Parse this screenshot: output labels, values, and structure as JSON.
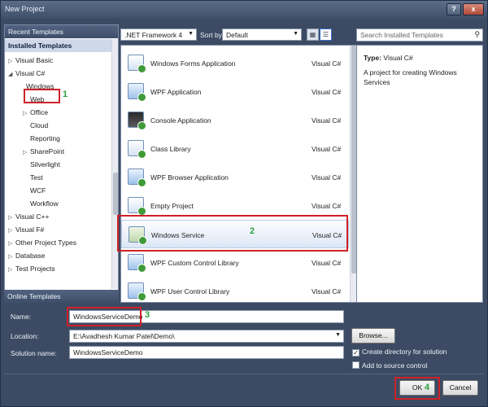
{
  "window": {
    "title": "New Project",
    "help_glyph": "?",
    "close_glyph": "x"
  },
  "left": {
    "recent_header": "Recent Templates",
    "installed_header": "Installed Templates",
    "tree": [
      {
        "label": "Visual Basic",
        "arrow": "▷"
      },
      {
        "label": "Visual C#",
        "arrow": "◢"
      },
      {
        "label": "Windows",
        "arrow": ""
      },
      {
        "label": "Web",
        "arrow": ""
      },
      {
        "label": "Office",
        "arrow": "▷"
      },
      {
        "label": "Cloud",
        "arrow": ""
      },
      {
        "label": "Reporting",
        "arrow": ""
      },
      {
        "label": "SharePoint",
        "arrow": "▷"
      },
      {
        "label": "Silverlight",
        "arrow": ""
      },
      {
        "label": "Test",
        "arrow": ""
      },
      {
        "label": "WCF",
        "arrow": ""
      },
      {
        "label": "Workflow",
        "arrow": ""
      },
      {
        "label": "Visual C++",
        "arrow": "▷"
      },
      {
        "label": "Visual F#",
        "arrow": "▷"
      },
      {
        "label": "Other Project Types",
        "arrow": "▷"
      },
      {
        "label": "Database",
        "arrow": "▷"
      },
      {
        "label": "Test Projects",
        "arrow": "▷"
      }
    ],
    "online_header": "Online Templates"
  },
  "toolbar": {
    "framework": ".NET Framework 4",
    "sort_label": "Sort by:",
    "sort_value": "Default"
  },
  "search": {
    "placeholder": "Search Installed Templates"
  },
  "templates": [
    {
      "name": "Windows Forms Application",
      "lang": "Visual C#"
    },
    {
      "name": "WPF Application",
      "lang": "Visual C#"
    },
    {
      "name": "Console Application",
      "lang": "Visual C#"
    },
    {
      "name": "Class Library",
      "lang": "Visual C#"
    },
    {
      "name": "WPF Browser Application",
      "lang": "Visual C#"
    },
    {
      "name": "Empty Project",
      "lang": "Visual C#"
    },
    {
      "name": "Windows Service",
      "lang": "Visual C#"
    },
    {
      "name": "WPF Custom Control Library",
      "lang": "Visual C#"
    },
    {
      "name": "WPF User Control Library",
      "lang": "Visual C#"
    }
  ],
  "info": {
    "type_label": "Type:",
    "type_value": "Visual C#",
    "description": "A project for creating Windows Services"
  },
  "form": {
    "name_label": "Name:",
    "name_value": "WindowsServiceDemo",
    "location_label": "Location:",
    "location_value": "E:\\Avadhesh Kumar Patel\\Demo\\",
    "solution_label": "Solution name:",
    "solution_value": "WindowsServiceDemo",
    "browse_label": "Browse...",
    "create_dir_label": "Create directory for solution",
    "create_dir_checked": "✓",
    "source_control_label": "Add to source control",
    "ok_label": "OK",
    "cancel_label": "Cancel"
  },
  "annotations": {
    "step1": "1",
    "step2": "2",
    "step3": "3",
    "step4": "4"
  }
}
